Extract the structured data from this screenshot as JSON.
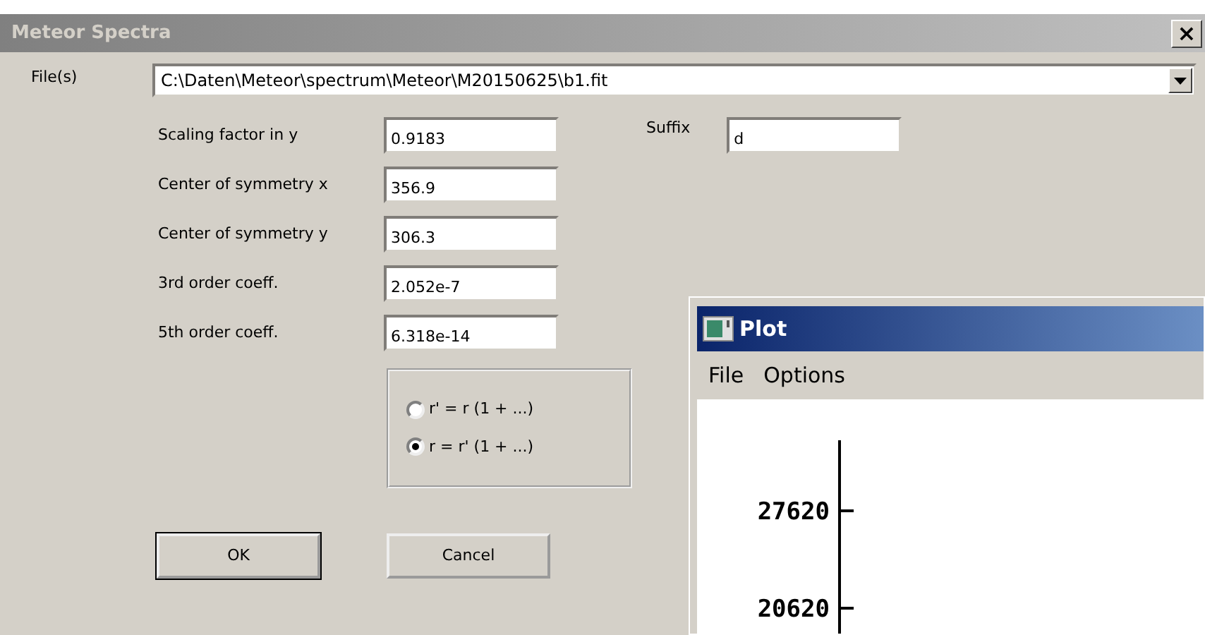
{
  "window": {
    "title": "Meteor Spectra",
    "close": "×"
  },
  "files": {
    "label": "File(s)",
    "value": "C:\\Daten\\Meteor\\spectrum\\Meteor\\M20150625\\b1.fit"
  },
  "fields": [
    {
      "label": "Scaling factor in y",
      "value": "0.9183"
    },
    {
      "label": "Center of symmetry x",
      "value": "356.9"
    },
    {
      "label": "Center of symmetry y",
      "value": "306.3"
    },
    {
      "label": "3rd order coeff.",
      "value": "2.052e-7"
    },
    {
      "label": "5th order coeff.",
      "value": "6.318e-14"
    }
  ],
  "suffix": {
    "label": "Suffix",
    "value": "d"
  },
  "radios": [
    {
      "label": "r' = r (1 + ...)",
      "selected": false
    },
    {
      "label": "r = r' (1 + ...)",
      "selected": true
    }
  ],
  "buttons": [
    {
      "label": "OK",
      "default": true
    },
    {
      "label": "Cancel",
      "default": false
    }
  ],
  "plot_window": {
    "title": "Plot",
    "menu": [
      "File",
      "Options"
    ],
    "tick_labels": [
      "27620",
      "20620"
    ]
  }
}
